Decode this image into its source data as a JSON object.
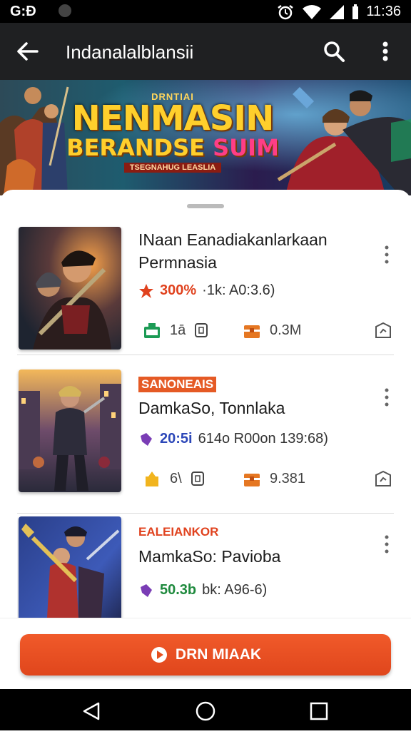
{
  "status_bar": {
    "left_text": "G:Ð",
    "time": "11:36"
  },
  "app_bar": {
    "title": "Indanalalblansii"
  },
  "banner": {
    "small_title": "DRNTIAI",
    "title_line1": "NENMASIN",
    "title_line2a": "BERANDSE",
    "title_line2b": "SUIM",
    "tagline": "TSEGNAHUG LEASLIA"
  },
  "cards": [
    {
      "tag": "",
      "name_line1": "INaan Eanadiakanlarkaan",
      "name_line2": "Permnasia",
      "stat_value": "300%",
      "stat_rest": "·1k: A0:3.6)",
      "stat_color": "#e0421e",
      "meta1": "1ā",
      "meta2": "0.3M"
    },
    {
      "tag": "SANONEAIS",
      "name_line1": "DamkaSo, Tonnlaka",
      "name_line2": "",
      "stat_value": "20:5i",
      "stat_rest": "614o R00on 139:68)",
      "stat_color": "#2c47b8",
      "meta1": "6\\",
      "meta2": "9.381"
    },
    {
      "tag": "EALEIANKOR",
      "name_line1": "MamkaSo: Pavioba",
      "name_line2": "",
      "stat_value": "50.3b",
      "stat_rest": "bk: A96-6)",
      "stat_color": "#1f8a3e",
      "meta1": "",
      "meta2": ""
    }
  ],
  "download_button": {
    "label": "DRN MIAAK"
  },
  "colors": {
    "accent": "#e8521f",
    "app_bar": "#1f2022"
  }
}
